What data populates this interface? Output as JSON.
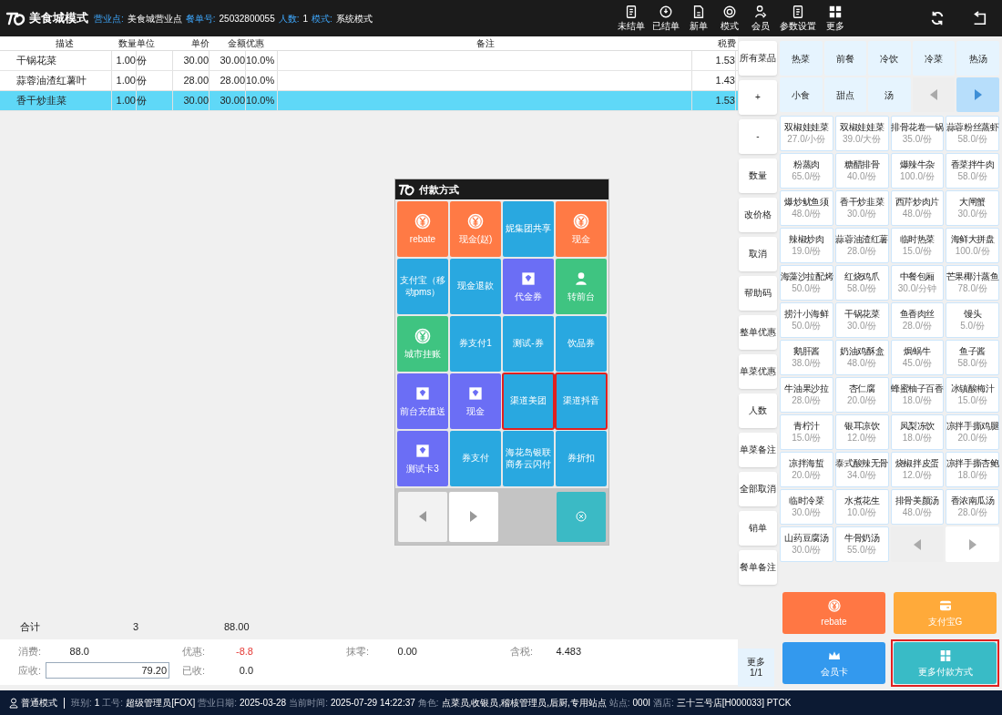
{
  "header": {
    "title": "美食城模式",
    "fields": [
      {
        "label": "营业点:",
        "value": "美食城营业点"
      },
      {
        "label": "餐单号:",
        "value": "25032800055"
      },
      {
        "label": "人数:",
        "value": "1"
      },
      {
        "label": "模式:",
        "value": "系统模式"
      }
    ]
  },
  "toolbar": [
    {
      "label": "未结单",
      "kind": "doc"
    },
    {
      "label": "已结单",
      "kind": "badge"
    },
    {
      "label": "新单",
      "kind": "page"
    },
    {
      "label": "模式",
      "kind": "ring"
    },
    {
      "label": "会员",
      "kind": "member"
    },
    {
      "label": "参数设置",
      "kind": "doc"
    },
    {
      "label": "更多",
      "kind": "grid"
    }
  ],
  "order_table": {
    "columns": [
      "描述",
      "数量",
      "单位",
      "单价",
      "金额",
      "优惠",
      "备注",
      "税费"
    ],
    "rows": [
      {
        "cells": [
          "干锅花菜",
          "1.00",
          "份",
          "30.00",
          "30.00",
          "10.0%",
          "",
          "1.53"
        ],
        "selected": false
      },
      {
        "cells": [
          "蒜蓉油渣红薯叶",
          "1.00",
          "份",
          "28.00",
          "28.00",
          "10.0%",
          "",
          "1.43"
        ],
        "selected": false
      },
      {
        "cells": [
          "香干炒韭菜",
          "1.00",
          "份",
          "30.00",
          "30.00",
          "10.0%",
          "",
          "1.53"
        ],
        "selected": true
      }
    ]
  },
  "totals": {
    "label": "合计",
    "quantity": "3",
    "amount": "88.00"
  },
  "summary": {
    "items": [
      {
        "label": "消费:",
        "value": "88.0",
        "kind": "normal"
      },
      {
        "label": "优惠:",
        "value": "-8.8",
        "kind": "negative"
      },
      {
        "label": "抹零:",
        "value": "0.00",
        "kind": "normal"
      },
      {
        "label": "含税:",
        "value": "4.483",
        "kind": "normal"
      }
    ],
    "due": {
      "label": "应收:",
      "value": "79.20"
    },
    "received": {
      "label": "已收:",
      "value": "0.0"
    }
  },
  "dialog": {
    "title": "付款方式",
    "tiles": [
      {
        "label": "rebate",
        "color": "#ff7a45",
        "kind": "yen",
        "highlighted": false
      },
      {
        "label": "现金(赵)",
        "color": "#ff7a45",
        "kind": "yen",
        "highlighted": false
      },
      {
        "label": "妮集团共享",
        "color": "#29a8e0",
        "kind": "plain",
        "highlighted": false
      },
      {
        "label": "现金",
        "color": "#ff7a45",
        "kind": "yen",
        "highlighted": false
      },
      {
        "label": "支付宝（移动pms）",
        "color": "#29a8e0",
        "kind": "plain",
        "highlighted": false
      },
      {
        "label": "现金退款",
        "color": "#29a8e0",
        "kind": "plain",
        "highlighted": false
      },
      {
        "label": "代金券",
        "color": "#6b6ef5",
        "kind": "voucher",
        "highlighted": false
      },
      {
        "label": "转前台",
        "color": "#3fc481",
        "kind": "person",
        "highlighted": false
      },
      {
        "label": "城市挂账",
        "color": "#3fc481",
        "kind": "yen",
        "highlighted": false
      },
      {
        "label": "券支付1",
        "color": "#29a8e0",
        "kind": "plain",
        "highlighted": false
      },
      {
        "label": "测试-券",
        "color": "#29a8e0",
        "kind": "plain",
        "highlighted": false
      },
      {
        "label": "饮品券",
        "color": "#29a8e0",
        "kind": "plain",
        "highlighted": false
      },
      {
        "label": "前台充值送",
        "color": "#6b6ef5",
        "kind": "voucher",
        "highlighted": false
      },
      {
        "label": "现金",
        "color": "#6b6ef5",
        "kind": "voucher",
        "highlighted": false
      },
      {
        "label": "渠道美团",
        "color": "#29a8e0",
        "kind": "plain",
        "highlighted": true
      },
      {
        "label": "渠道抖音",
        "color": "#29a8e0",
        "kind": "plain",
        "highlighted": true
      },
      {
        "label": "测试卡3",
        "color": "#6b6ef5",
        "kind": "voucher",
        "highlighted": false
      },
      {
        "label": "券支付",
        "color": "#29a8e0",
        "kind": "plain",
        "highlighted": false
      },
      {
        "label": "海花岛银联商务云闪付",
        "color": "#29a8e0",
        "kind": "plain",
        "highlighted": false
      },
      {
        "label": "券折扣",
        "color": "#29a8e0",
        "kind": "plain",
        "highlighted": false
      }
    ]
  },
  "side_actions": [
    "所有菜品",
    "+",
    "-",
    "数量",
    "改价格",
    "取消",
    "帮助码",
    "整单优惠",
    "单菜优惠",
    "人数",
    "单菜备注",
    "全部取消",
    "销单",
    "餐单备注"
  ],
  "categories": [
    "热菜",
    "前餐",
    "冷饮",
    "冷菜",
    "热汤",
    "小食",
    "甜点",
    "汤"
  ],
  "dishes": [
    {
      "name": "双椒娃娃菜",
      "price": "27.0/小份"
    },
    {
      "name": "双椒娃娃菜",
      "price": "39.0/大份"
    },
    {
      "name": "排骨花卷一锅",
      "price": "35.0/份"
    },
    {
      "name": "蒜蓉粉丝蒸虾",
      "price": "58.0/份"
    },
    {
      "name": "粉蒸肉",
      "price": "65.0/份"
    },
    {
      "name": "糖醋排骨",
      "price": "40.0/份"
    },
    {
      "name": "爆辣牛杂",
      "price": "100.0/份"
    },
    {
      "name": "香菜拌牛肉",
      "price": "58.0/份"
    },
    {
      "name": "爆炒鱿鱼须",
      "price": "48.0/份"
    },
    {
      "name": "香干炒韭菜",
      "price": "30.0/份"
    },
    {
      "name": "西芹炒肉片",
      "price": "48.0/份"
    },
    {
      "name": "大闸蟹",
      "price": "30.0/份"
    },
    {
      "name": "辣椒炒肉",
      "price": "19.0/份"
    },
    {
      "name": "蒜蓉油渣红薯",
      "price": "28.0/份"
    },
    {
      "name": "临时热菜",
      "price": "15.0/份"
    },
    {
      "name": "海鲜大拼盘",
      "price": "100.0/份"
    },
    {
      "name": "海藻沙拉配烤",
      "price": "50.0/份"
    },
    {
      "name": "红烧鸡爪",
      "price": "58.0/份"
    },
    {
      "name": "中餐包厢",
      "price": "30.0/分钟"
    },
    {
      "name": "芒果椰汁蒸鱼",
      "price": "78.0/份"
    },
    {
      "name": "捞汁小海鲜",
      "price": "50.0/份"
    },
    {
      "name": "干锅花菜",
      "price": "30.0/份"
    },
    {
      "name": "鱼香肉丝",
      "price": "28.0/份"
    },
    {
      "name": "馒头",
      "price": "5.0/份"
    },
    {
      "name": "鹅肝酱",
      "price": "38.0/份"
    },
    {
      "name": "奶油鸡酥盒",
      "price": "48.0/份"
    },
    {
      "name": "焗蜗牛",
      "price": "45.0/份"
    },
    {
      "name": "鱼子酱",
      "price": "58.0/份"
    },
    {
      "name": "牛油果沙拉",
      "price": "28.0/份"
    },
    {
      "name": "杏仁腐",
      "price": "20.0/份"
    },
    {
      "name": "蜂蜜柚子百香",
      "price": "18.0/份"
    },
    {
      "name": "冰镇酸梅汁",
      "price": "15.0/份"
    },
    {
      "name": "青柠汁",
      "price": "15.0/份"
    },
    {
      "name": "银耳凉饮",
      "price": "12.0/份"
    },
    {
      "name": "凤梨冻饮",
      "price": "18.0/份"
    },
    {
      "name": "凉拌手撕鸡腿",
      "price": "20.0/份"
    },
    {
      "name": "凉拌海蜇",
      "price": "20.0/份"
    },
    {
      "name": "泰式酸辣无骨",
      "price": "34.0/份"
    },
    {
      "name": "烧椒拌皮蛋",
      "price": "12.0/份"
    },
    {
      "name": "凉拌手撕杏鲍",
      "price": "18.0/份"
    },
    {
      "name": "临时冷菜",
      "price": "30.0/份"
    },
    {
      "name": "水煮花生",
      "price": "10.0/份"
    },
    {
      "name": "排骨美颜汤",
      "price": "48.0/份"
    },
    {
      "name": "香浓南瓜汤",
      "price": "28.0/份"
    },
    {
      "name": "山药豆腐汤",
      "price": "30.0/份"
    },
    {
      "name": "牛骨奶汤",
      "price": "55.0/份"
    }
  ],
  "more": {
    "label": "更多",
    "page": "1/1"
  },
  "payments": [
    {
      "label": "rebate",
      "color": "#ff7744",
      "kind": "yen",
      "highlighted": false
    },
    {
      "label": "支付宝G",
      "color": "#ffaa3a",
      "kind": "wallet",
      "highlighted": false
    },
    {
      "label": "会员卡",
      "color": "#3399ee",
      "kind": "crown",
      "highlighted": false
    },
    {
      "label": "更多付款方式",
      "color": "#39bbc6",
      "kind": "grid",
      "highlighted": true
    }
  ],
  "status_bar": {
    "mode": "普通模式",
    "fields": [
      {
        "label": "班别:",
        "value": "1"
      },
      {
        "label": "工号:",
        "value": "超级管理员[FOX]"
      },
      {
        "label": "营业日期:",
        "value": "2025-03-28"
      },
      {
        "label": "当前时间:",
        "value": "2025-07-29 14:22:37"
      },
      {
        "label": "角色:",
        "value": "点菜员,收银员,稽核管理员,后厨,专用站点"
      },
      {
        "label": "站点:",
        "value": "000I"
      },
      {
        "label": "酒店:",
        "value": "三十三号店[H000033] PTCK"
      }
    ]
  }
}
